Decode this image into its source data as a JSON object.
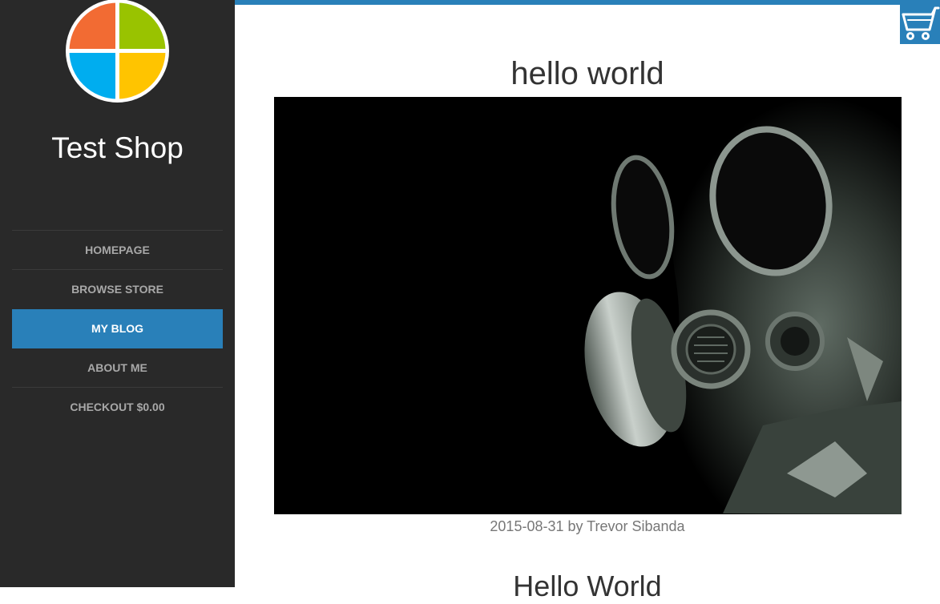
{
  "sidebar": {
    "shop_name": "Test Shop",
    "logo": "four-color-windows-logo",
    "nav": [
      {
        "label": "HOMEPAGE",
        "active": false
      },
      {
        "label": "BROWSE STORE",
        "active": false
      },
      {
        "label": "MY BLOG",
        "active": true
      },
      {
        "label": "ABOUT ME",
        "active": false
      },
      {
        "label": "CHECKOUT $0.00",
        "active": false
      }
    ]
  },
  "header": {
    "cart_icon": "shopping-cart-icon"
  },
  "post": {
    "title": "hello world",
    "image": "gas-mask-photo",
    "meta": "2015-08-31 by Trevor Sibanda",
    "heading": "Hello World"
  },
  "colors": {
    "accent": "#2980b9",
    "sidebar_bg": "#292929",
    "logo_orange": "#f26b33",
    "logo_green": "#99c300",
    "logo_blue": "#00adef",
    "logo_yellow": "#ffc400"
  }
}
